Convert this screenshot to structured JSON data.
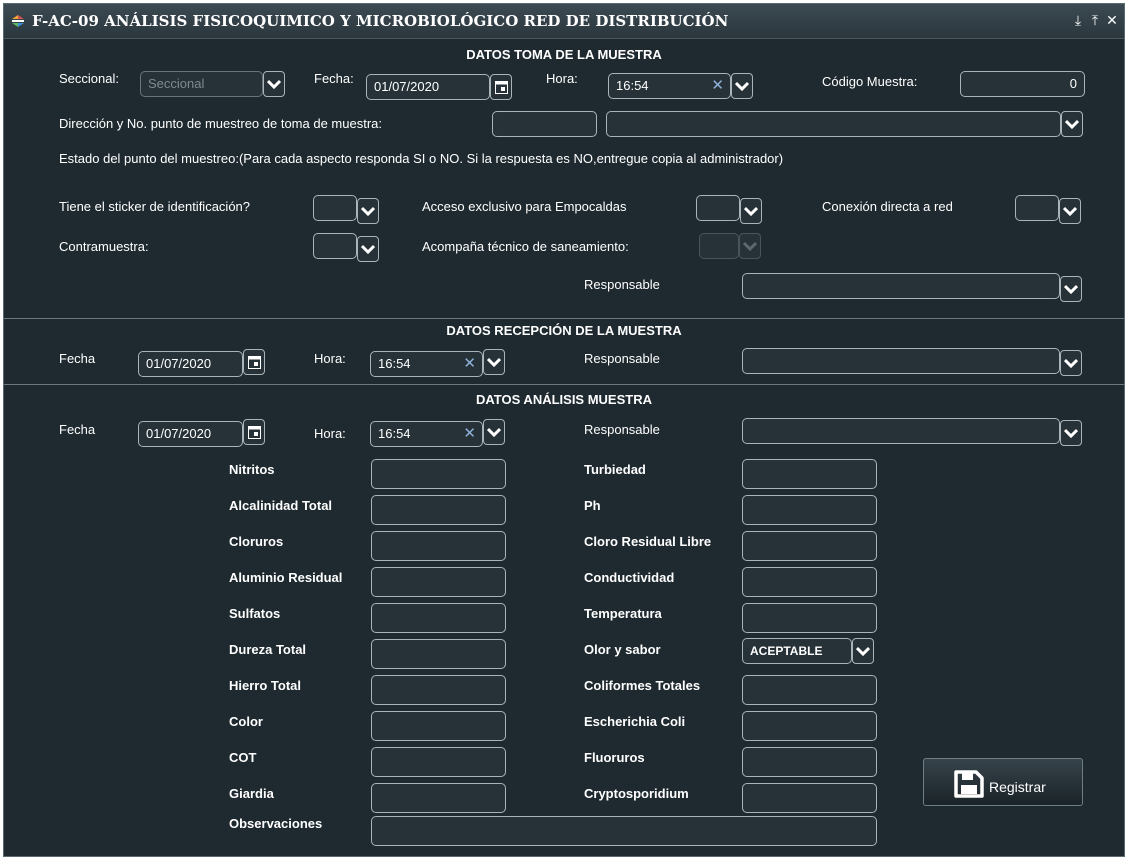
{
  "window": {
    "title": "F-AC-09 ANÁLISIS FISICOQUIMICO Y MICROBIOLÓGICO RED DE DISTRIBUCIÓN"
  },
  "toma": {
    "title": "DATOS TOMA DE LA MUESTRA",
    "seccional_label": "Seccional:",
    "seccional_placeholder": "Seccional",
    "fecha_label": "Fecha:",
    "fecha_value": "01/07/2020",
    "hora_label": "Hora:",
    "hora_value": "16:54",
    "codigo_label": "Código Muestra:",
    "codigo_value": "0",
    "direccion_label": "Dirección y No. punto de muestreo de toma de muestra:",
    "estado_text": "Estado del punto del muestreo:(Para cada aspecto responda SI o NO. Si la respuesta es NO,entregue copia al administrador)",
    "sticker_label": "Tiene el sticker de identificación?",
    "acceso_label": "Acceso exclusivo para Empocaldas",
    "conexion_label": "Conexión directa a red",
    "contramuestra_label": "Contramuestra:",
    "acompana_label": "Acompaña técnico de saneamiento:",
    "responsable_label": "Responsable"
  },
  "recepcion": {
    "title": "DATOS RECEPCIÓN DE LA MUESTRA",
    "fecha_label": "Fecha",
    "fecha_value": "01/07/2020",
    "hora_label": "Hora:",
    "hora_value": "16:54",
    "responsable_label": "Responsable"
  },
  "analisis": {
    "title": "DATOS ANÁLISIS MUESTRA",
    "fecha_label": "Fecha",
    "fecha_value": "01/07/2020",
    "hora_label": "Hora:",
    "hora_value": "16:54",
    "responsable_label": "Responsable",
    "left_fields": [
      "Nitritos",
      "Alcalinidad Total",
      "Cloruros",
      "Aluminio Residual",
      "Sulfatos",
      "Dureza Total",
      "Hierro Total",
      "Color",
      "COT",
      "Giardia"
    ],
    "right_fields": [
      "Turbiedad",
      "Ph",
      "Cloro Residual Libre",
      "Conductividad",
      "Temperatura",
      "Olor y sabor",
      "Coliformes Totales",
      "Escherichia Coli",
      "Fluoruros",
      "Cryptosporidium"
    ],
    "olor_value": "ACEPTABLE",
    "observaciones_label": "Observaciones"
  },
  "actions": {
    "registrar_label": "Registrar"
  },
  "icons": {
    "window_controls": [
      "download-icon",
      "pin-icon",
      "close-icon"
    ],
    "save": "floppy-disk-icon"
  }
}
